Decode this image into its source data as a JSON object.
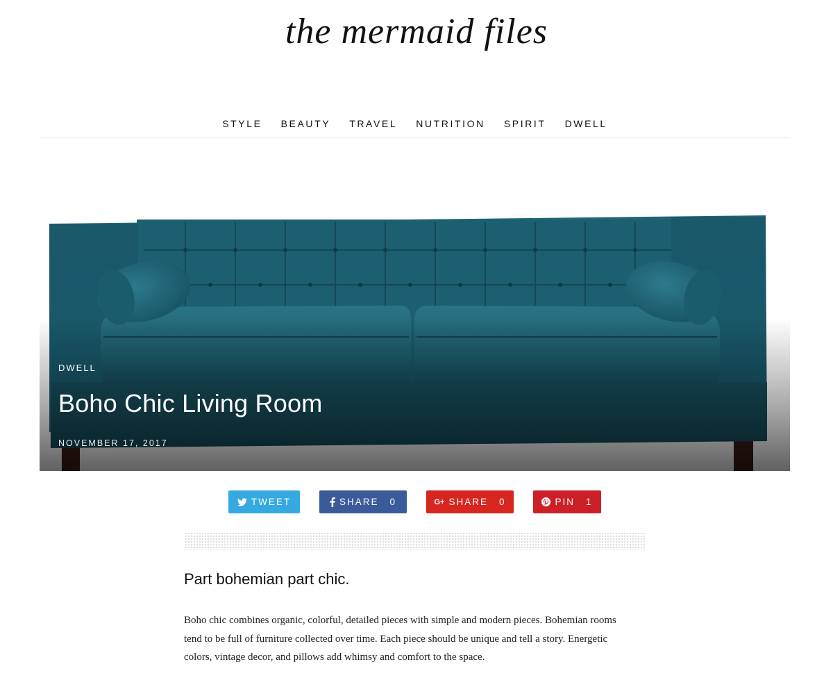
{
  "site": {
    "logo": "the mermaid files"
  },
  "nav": {
    "items": [
      "STYLE",
      "BEAUTY",
      "TRAVEL",
      "NUTRITION",
      "SPIRIT",
      "DWELL"
    ]
  },
  "hero": {
    "category": "DWELL",
    "title": "Boho Chic Living Room",
    "date": "NOVEMBER 17, 2017",
    "image_subject": "teal velvet tufted sofa with bolster pillows"
  },
  "share": {
    "tweet": {
      "label": "TWEET"
    },
    "facebook": {
      "label": "SHARE",
      "count": "0"
    },
    "google": {
      "label": "SHARE",
      "count": "0"
    },
    "pinterest": {
      "label": "PIN",
      "count": "1"
    }
  },
  "article": {
    "lead": "Part bohemian part chic.",
    "paragraph": "Boho chic combines organic, colorful, detailed pieces with simple and modern pieces. Bohemian rooms tend to be full of furniture collected over time. Each piece should be unique and tell a story. Energetic colors, vintage decor, and pillows add whimsy and comfort to the space."
  },
  "colors": {
    "twitter": "#35a9e0",
    "facebook": "#3b5a9a",
    "google": "#d6261f",
    "pinterest": "#cc1f27",
    "sofa": "#1b5a6c"
  }
}
